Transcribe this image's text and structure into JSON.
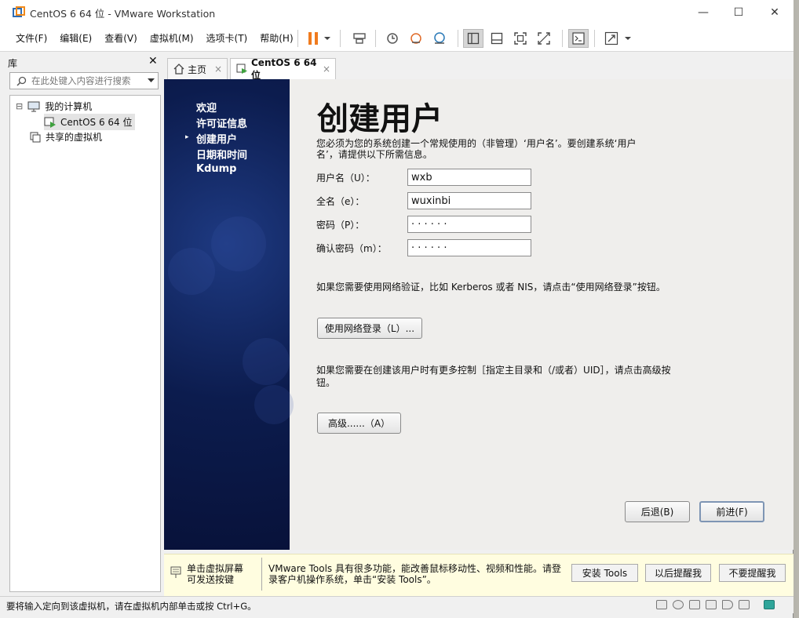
{
  "window": {
    "title": "CentOS 6 64 位 - VMware Workstation",
    "controls": {
      "minimize": "—",
      "maximize": "☐",
      "close": "✕"
    }
  },
  "menubar": {
    "items": [
      "文件(F)",
      "编辑(E)",
      "查看(V)",
      "虚拟机(M)",
      "选项卡(T)",
      "帮助(H)"
    ]
  },
  "toolbar": {
    "icons": [
      "pause-icon",
      "dropdown-arrow-icon",
      "send-keys-icon",
      "snapshot-icon",
      "revert-snapshot-icon",
      "snapshot-manager-icon",
      "library-view-icon",
      "thumbnail-view-icon",
      "fullscreen-icon",
      "unity-icon",
      "console-icon",
      "stretch-icon",
      "dropdown-arrow-icon"
    ]
  },
  "library": {
    "title": "库",
    "close": "✕",
    "search_placeholder": "在此处键入内容进行搜索",
    "tree": [
      {
        "label": "我的计算机",
        "expander": "⊟"
      },
      {
        "label": "CentOS 6 64 位"
      },
      {
        "label": "共享的虚拟机"
      }
    ]
  },
  "tabs": [
    {
      "label": "主页",
      "close": "×"
    },
    {
      "label": "CentOS 6 64 位",
      "close": "×"
    }
  ],
  "installer": {
    "steps": [
      "欢迎",
      "许可证信息",
      "创建用户",
      "日期和时间",
      "Kdump"
    ],
    "current_step_marker": "▸",
    "heading": "创建用户",
    "intro_line1": "您必须为您的系统创建一个常规使用的（非管理）‘用户名’。要创建系统‘用户",
    "intro_line2": "名’，请提供以下所需信息。",
    "fields": [
      {
        "label": "用户名（U）：",
        "value": "wxb"
      },
      {
        "label": "全名（e）：",
        "value": "wuxinbi"
      },
      {
        "label": "密码（P）：",
        "value": "· · · · · ·"
      },
      {
        "label": "确认密码（m）：",
        "value": "· · · · · ·"
      }
    ],
    "network_text": "如果您需要使用网络验证，比如 Kerberos 或者 NIS，请点击“使用网络登录”按钮。",
    "network_button": "使用网络登录（L）...",
    "advanced_text_line1": "如果您需要在创建该用户时有更多控制［指定主目录和（/或者）UID］，请点击高级按",
    "advanced_text_line2": "钮。",
    "advanced_button": "高级......（A）",
    "back_button": "后退(B)",
    "next_button": "前进(F)"
  },
  "notification": {
    "hint_line1": "单击虚拟屏幕",
    "hint_line2": "可发送按键",
    "message_line1": "VMware Tools 具有很多功能，能改善鼠标移动性、视频和性能。请登",
    "message_line2": "录客户机操作系统，单击“安装 Tools”。",
    "install_button": "安装 Tools",
    "remind_later_button": "以后提醒我",
    "never_remind_button": "不要提醒我"
  },
  "statusbar": {
    "text": "要将输入定向到该虚拟机，请在虚拟机内部单击或按 Ctrl+G。"
  },
  "colors": {
    "installer_sidebar": "#0c1c4e",
    "pause_orange": "#f07b1e",
    "notification_bg": "#fffde0"
  }
}
